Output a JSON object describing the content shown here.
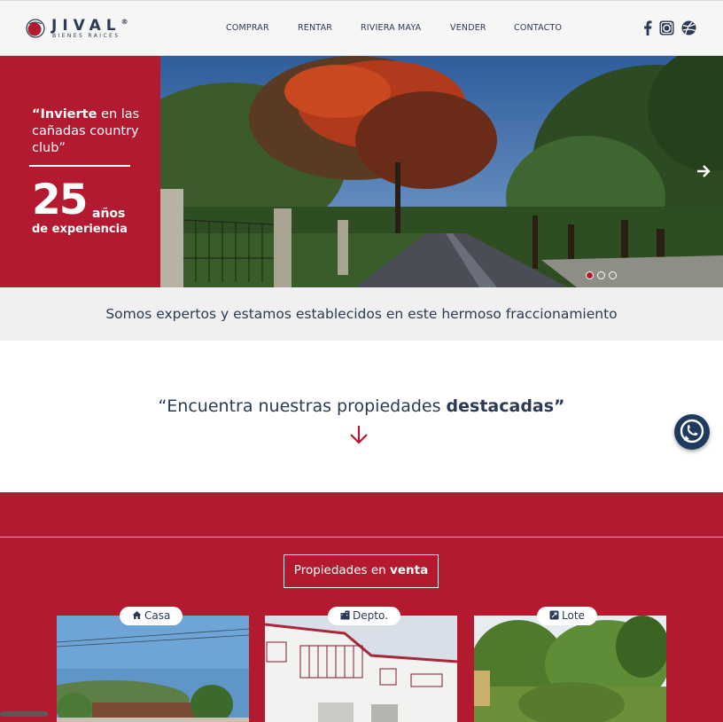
{
  "brand": {
    "name": "JIVAL",
    "registered": "®",
    "subtitle": "BIENES RAICES",
    "accent": "#b3192f",
    "navy": "#2b3a55"
  },
  "nav": {
    "items": [
      "COMPRAR",
      "RENTAR",
      "RIVIERA MAYA",
      "VENDER",
      "CONTACTO"
    ]
  },
  "social": {
    "icons": [
      "facebook-icon",
      "instagram-icon",
      "dribbble-icon"
    ]
  },
  "hero": {
    "quote_open": "“",
    "quote_bold": "Invierte",
    "quote_rest": " en las cañadas country club”",
    "years_number": "25",
    "years_word": "años",
    "years_caption": "de experiencia",
    "slides_total": 3,
    "active_slide": 1
  },
  "tagline": "Somos expertos y estamos establecidos en este hermoso fraccionamiento",
  "featured": {
    "text": "“Encuentra nuestras propiedades ",
    "bold": "destacadas",
    "close": "”"
  },
  "listings": {
    "button_text": "Propiedades en ",
    "button_bold": "venta",
    "cards": [
      {
        "type": "Casa",
        "icon": "house-icon"
      },
      {
        "type": "Depto.",
        "icon": "building-icon"
      },
      {
        "type": "Lote",
        "icon": "lot-icon"
      }
    ]
  }
}
